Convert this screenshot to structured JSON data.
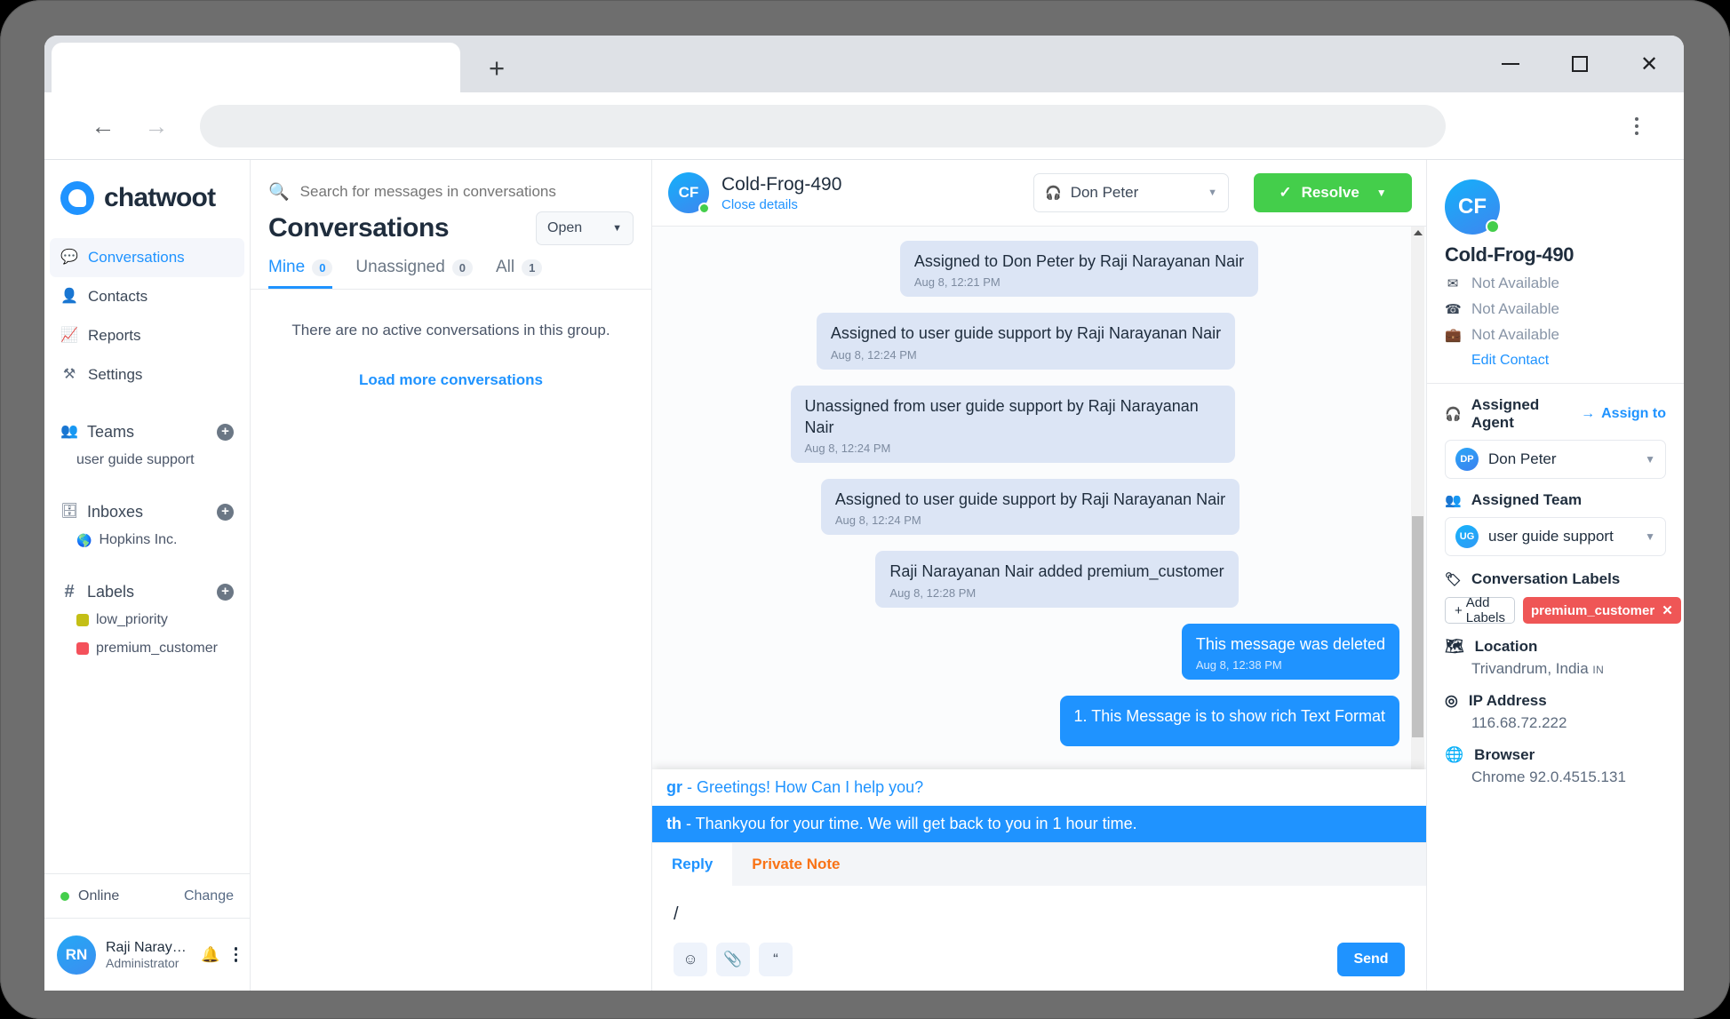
{
  "browser": {
    "tab_title": "",
    "address_value": "",
    "back_icon": "arrow-left-icon",
    "forward_icon": "arrow-right-icon",
    "reload_icon": "reload-icon",
    "newtab_label": "+",
    "minimize_label": "minimize",
    "maximize_label": "maximize",
    "close_label": "✕"
  },
  "sidebar": {
    "brand": "chatwoot",
    "nav": [
      {
        "label": "Conversations",
        "icon": "chat-icon",
        "active": true
      },
      {
        "label": "Contacts",
        "icon": "person-icon",
        "active": false
      },
      {
        "label": "Reports",
        "icon": "trending-up-icon",
        "active": false
      },
      {
        "label": "Settings",
        "icon": "tools-icon",
        "active": false
      }
    ],
    "teams": {
      "title": "Teams",
      "icon": "team-icon",
      "add": "+",
      "items": [
        {
          "label": "user guide support"
        }
      ]
    },
    "inboxes": {
      "title": "Inboxes",
      "icon": "inbox-icon",
      "add": "+",
      "items": [
        {
          "label": "Hopkins Inc.",
          "icon": "globe-icon"
        }
      ]
    },
    "labels": {
      "title": "Labels",
      "icon": "hash-icon",
      "add": "+",
      "items": [
        {
          "label": "low_priority",
          "color": "#c4bf16"
        },
        {
          "label": "premium_customer",
          "color": "#f4515b"
        }
      ]
    },
    "status": {
      "text": "Online",
      "change": "Change",
      "color": "#44ce4b"
    },
    "profile": {
      "initials": "RN",
      "name": "Raji Narayanan ...",
      "role": "Administrator"
    }
  },
  "conversations": {
    "search_placeholder": "Search for messages in conversations",
    "title": "Conversations",
    "status_filter": "Open",
    "tabs": [
      {
        "label": "Mine",
        "count": "0",
        "selected": true
      },
      {
        "label": "Unassigned",
        "count": "0",
        "selected": false
      },
      {
        "label": "All",
        "count": "1",
        "selected": false
      }
    ],
    "empty_text": "There are no active conversations in this group.",
    "load_more": "Load more conversations"
  },
  "chat": {
    "avatar_initials": "CF",
    "contact_name": "Cold-Frog-490",
    "close_details": "Close details",
    "agent_select": "Don Peter",
    "agent_icon": "headset-icon",
    "resolve_label": "Resolve",
    "resolve_color": "#44ce4b",
    "messages": [
      {
        "text": "Assigned to Don Peter by Raji Narayanan Nair",
        "time": "Aug 8, 12:21 PM",
        "type": "sys",
        "align": "c",
        "indent": 0
      },
      {
        "text": "Assigned to user guide support by Raji Narayanan Nair",
        "time": "Aug 8, 12:24 PM",
        "type": "sys",
        "align": "c",
        "indent": 0
      },
      {
        "text": "Unassigned from user guide support by Raji Narayanan Nair",
        "time": "Aug 8, 12:24 PM",
        "type": "sys",
        "align": "c",
        "indent": 0
      },
      {
        "text": "Assigned to user guide support by Raji Narayanan Nair",
        "time": "Aug 8, 12:24 PM",
        "type": "sys",
        "align": "c",
        "indent": 0
      },
      {
        "text": "Raji Narayanan Nair added premium_customer",
        "time": "Aug 8, 12:28 PM",
        "type": "sys",
        "align": "c",
        "indent": 0
      },
      {
        "text": "This message was deleted",
        "time": "Aug 8, 12:38 PM",
        "type": "out",
        "align": "r",
        "indent": 0
      },
      {
        "text": "1. This Message is to show rich Text Format",
        "time": "",
        "type": "out",
        "align": "r",
        "indent": 0
      }
    ],
    "suggestions": [
      {
        "code": "gr",
        "text": "- Greetings! How Can I help you?",
        "highlighted": false
      },
      {
        "code": "th",
        "text": "- Thankyou for your time. We will get back to you in 1 hour time.",
        "highlighted": true
      }
    ],
    "editor": {
      "tab_reply": "Reply",
      "tab_note": "Private Note",
      "input_value": "/",
      "emoji_icon": "emoji-icon",
      "attach_icon": "paperclip-icon",
      "quote_icon": "quote-icon",
      "send_label": "Send"
    }
  },
  "contact_panel": {
    "avatar_initials": "CF",
    "name": "Cold-Frog-490",
    "email": "Not Available",
    "phone": "Not Available",
    "company": "Not Available",
    "email_icon": "envelope-icon",
    "phone_icon": "phone-icon",
    "company_icon": "briefcase-icon",
    "edit_contact": "Edit Contact",
    "assigned_agent_title": "Assigned Agent",
    "assigned_agent_icon": "headset-icon",
    "assign_to_link": "Assign to",
    "agent_initials": "DP",
    "agent_name": "Don Peter",
    "assigned_team_title": "Assigned Team",
    "assigned_team_icon": "team-icon",
    "team_initials": "UG",
    "team_name": "user guide support",
    "labels_title": "Conversation Labels",
    "labels_icon": "tag-icon",
    "add_labels": "Add Labels",
    "label_chip": "premium_customer",
    "label_chip_color": "#ef5656",
    "location_title": "Location",
    "location_icon": "map-icon",
    "location_value": "Trivandrum, India",
    "location_country": "IN",
    "ip_title": "IP Address",
    "ip_icon": "target-icon",
    "ip_value": "116.68.72.222",
    "browser_title": "Browser",
    "browser_icon": "globe-icon",
    "browser_value": "Chrome 92.0.4515.131"
  }
}
